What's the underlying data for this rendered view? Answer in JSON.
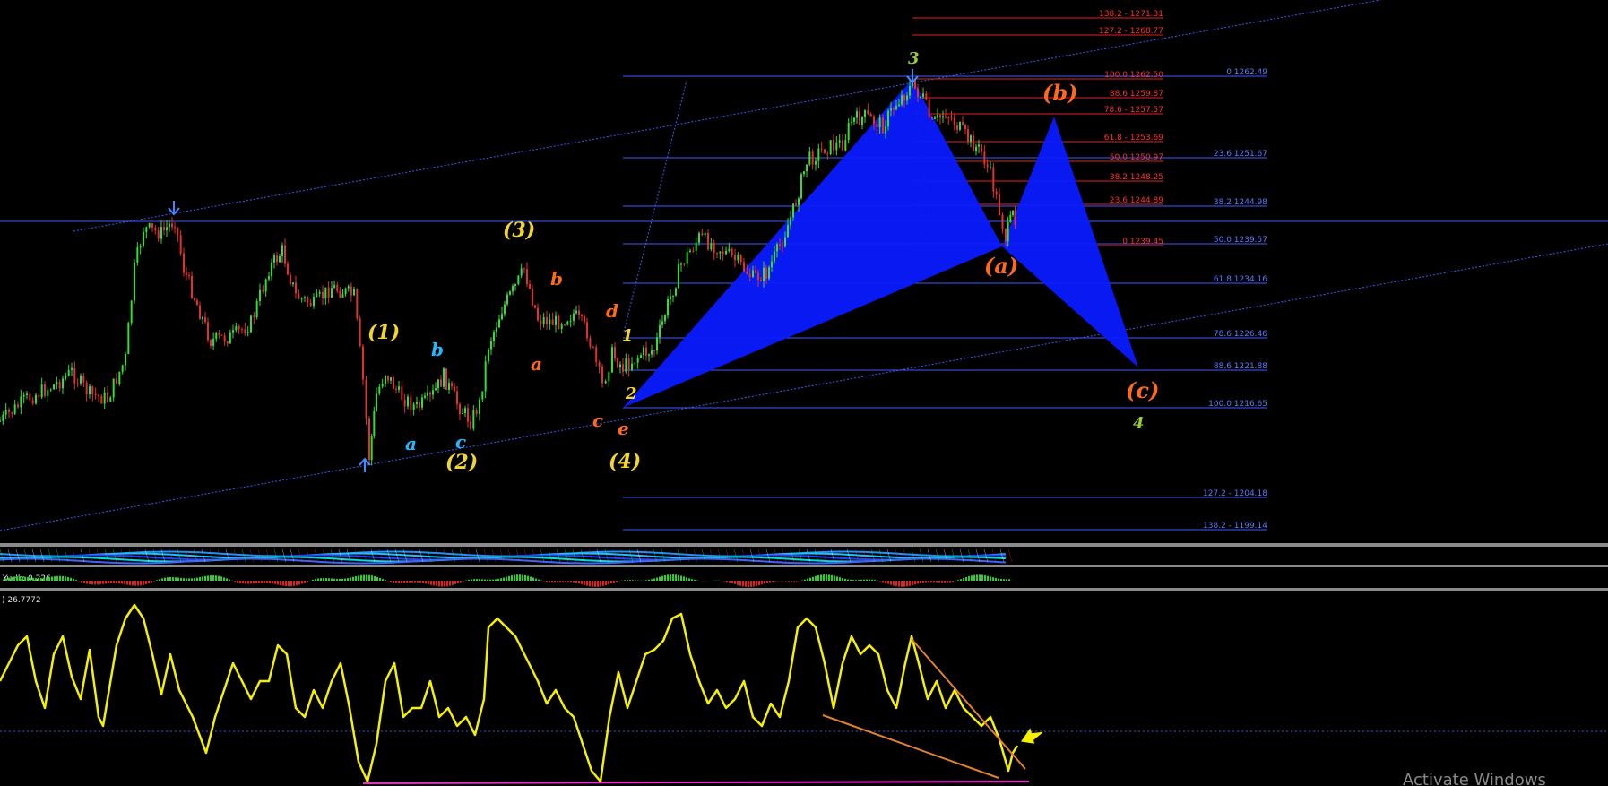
{
  "colors": {
    "background": "#000000",
    "bull_candle": "#33dd33",
    "bear_candle": "#e03030",
    "fib_blue": "#3a5cff",
    "fib_red": "#e02020",
    "pattern_fill": "#0a1aff",
    "wave_yellow": "#f2d62c",
    "wave_orange": "#ff6a1a",
    "wave_cyan": "#22b8ff",
    "wave_green": "#9acd32",
    "arrow_blue": "#3a8cff",
    "oscillator": "#f5f000",
    "trendline_orange": "#e08030",
    "support_magenta": "#ff22dd",
    "separator": "#8a8a8a"
  },
  "header": {
    "main_title": ""
  },
  "fib_right": [
    {
      "level": "0",
      "price": "1262.49",
      "label": "0  1262.49"
    },
    {
      "level": "23.6",
      "price": "1251.67",
      "label": "23.6  1251.67"
    },
    {
      "level": "38.2",
      "price": "1244.98",
      "label": "38.2  1244.98"
    },
    {
      "level": "50.0",
      "price": "1239.57",
      "label": "50.0  1239.57"
    },
    {
      "level": "61.8",
      "price": "1234.16",
      "label": "61.8  1234.16"
    },
    {
      "level": "78.6",
      "price": "1226.46",
      "label": "78.6  1226.46"
    },
    {
      "level": "88.6",
      "price": "1221.88",
      "label": "88.6  1221.88"
    },
    {
      "level": "100.0",
      "price": "1216.65",
      "label": "100.0  1216.65"
    },
    {
      "level": "127.2",
      "price": "1204.18",
      "label": "127.2 - 1204.18"
    },
    {
      "level": "138.2",
      "price": "1199.14",
      "label": "138.2 - 1199.14"
    }
  ],
  "fib_red": [
    {
      "label": "138.2 - 1271.31"
    },
    {
      "label": "127.2 - 1268.77"
    },
    {
      "label": "100.0  1262.50"
    },
    {
      "label": "88.6  1259.87"
    },
    {
      "label": "78.6 - 1257.57"
    },
    {
      "label": "61.8 - 1253.69"
    },
    {
      "label": "50.0  1250.97"
    },
    {
      "label": "38.2  1248.25"
    },
    {
      "label": "23.6  1244.89"
    },
    {
      "label": "0  1239.45"
    }
  ],
  "wave_labels": {
    "w1": "(1)",
    "w2": "(2)",
    "w3": "(3)",
    "w4": "(4)",
    "a_cyan": "a",
    "b_cyan": "b",
    "c_cyan": "c",
    "a_orange": "a",
    "b_orange": "b",
    "c_orange": "c",
    "d_orange": "d",
    "e_orange": "e",
    "sub1": "1",
    "sub2": "2",
    "sub3": "3",
    "sub4": "4",
    "big_a": "(a)",
    "big_b": "(b)",
    "big_c": "(c)"
  },
  "indicators": {
    "histogram_label": "YuHk: 0.226",
    "oscillator_label": ") 26.7772"
  },
  "watermark": "Activate Windows"
}
